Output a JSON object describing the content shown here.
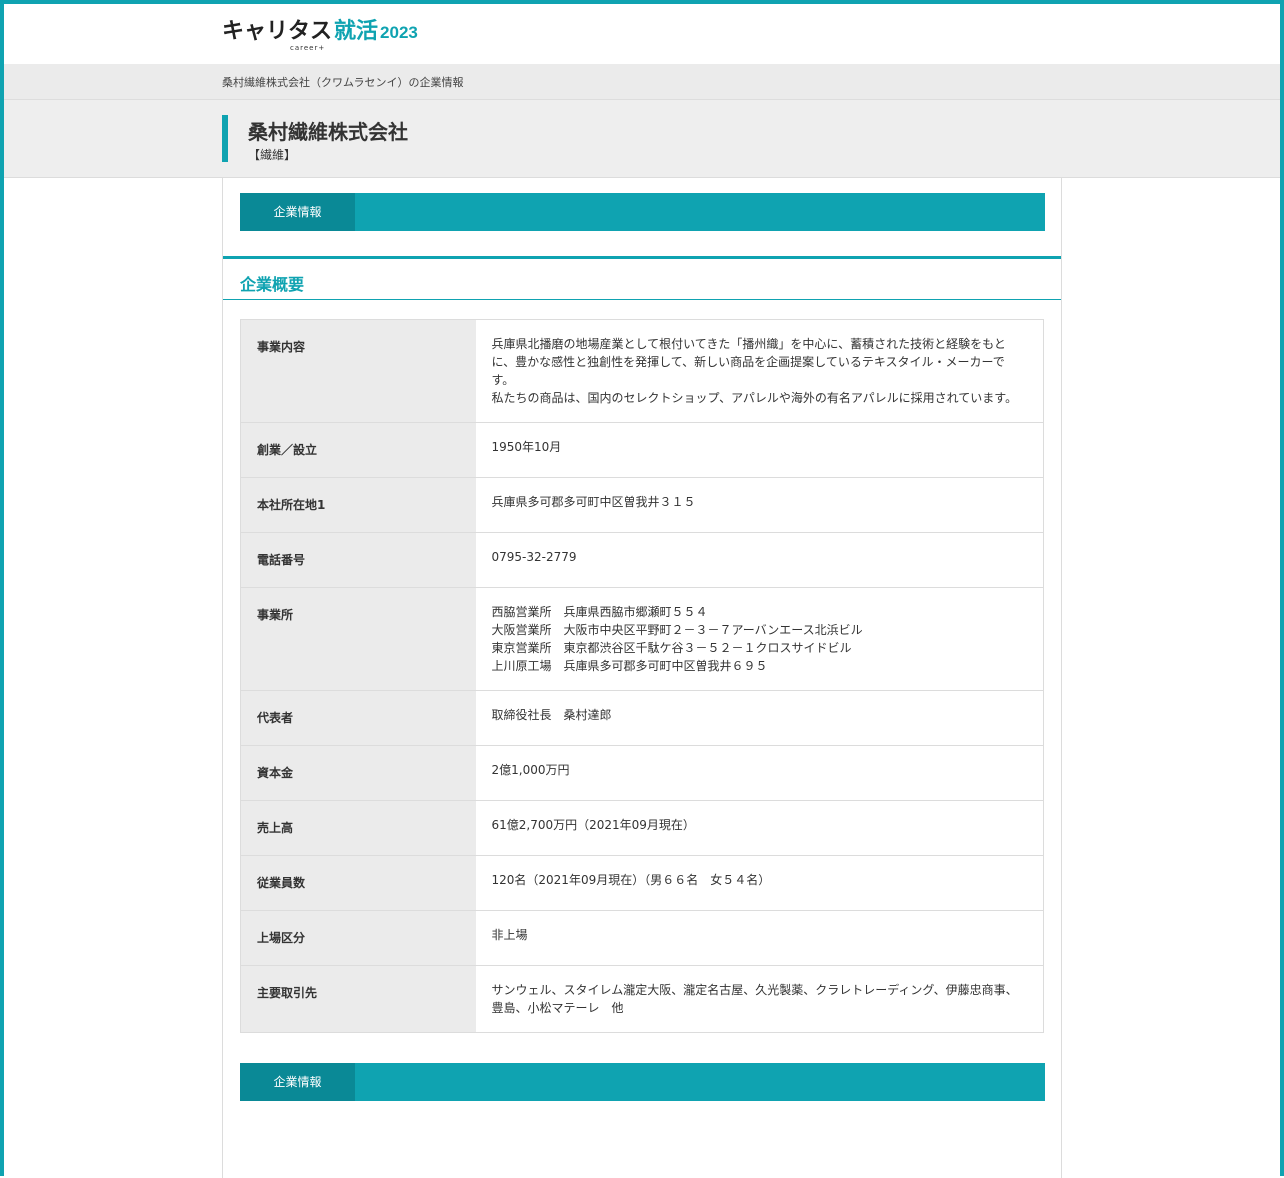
{
  "header": {
    "logo_main": "キャリタス",
    "logo_accent": "就活",
    "logo_year": "2023",
    "logo_sub": "career+"
  },
  "breadcrumb": "桑村繊維株式会社（クワムラセンイ）の企業情報",
  "company": {
    "name": "桑村繊維株式会社",
    "industry": "【繊維】"
  },
  "tabs": {
    "top_tab": "企業情報",
    "bottom_tab": "企業情報"
  },
  "section": {
    "title": "企業概要"
  },
  "rows": [
    {
      "label": "事業内容",
      "value": "兵庫県北播磨の地場産業として根付いてきた「播州織」を中心に、蓄積された技術と経験をもとに、豊かな感性と独創性を発揮して、新しい商品を企画提案しているテキスタイル・メーカーです。\n私たちの商品は、国内のセレクトショップ、アパレルや海外の有名アパレルに採用されています。"
    },
    {
      "label": "創業／設立",
      "value": "1950年10月"
    },
    {
      "label": "本社所在地1",
      "value": "兵庫県多可郡多可町中区曽我井３１５"
    },
    {
      "label": "電話番号",
      "value": "0795-32-2779"
    },
    {
      "label": "事業所",
      "value": "西脇営業所　兵庫県西脇市郷瀬町５５４\n大阪営業所　大阪市中央区平野町２－３－７アーバンエース北浜ビル\n東京営業所　東京都渋谷区千駄ケ谷３－５２－１クロスサイドビル\n上川原工場　兵庫県多可郡多可町中区曽我井６９５"
    },
    {
      "label": "代表者",
      "value": "取締役社長　桑村達郎"
    },
    {
      "label": "資本金",
      "value": "2億1,000万円"
    },
    {
      "label": "売上高",
      "value": "61億2,700万円（2021年09月現在）"
    },
    {
      "label": "従業員数",
      "value": "120名（2021年09月現在）（男６６名　女５４名）"
    },
    {
      "label": "上場区分",
      "value": "非上場"
    },
    {
      "label": "主要取引先",
      "value": "サンウェル、スタイレム瀧定大阪、瀧定名古屋、久光製薬、クラレトレーディング、伊藤忠商事、豊島、小松マテーレ　他"
    }
  ]
}
